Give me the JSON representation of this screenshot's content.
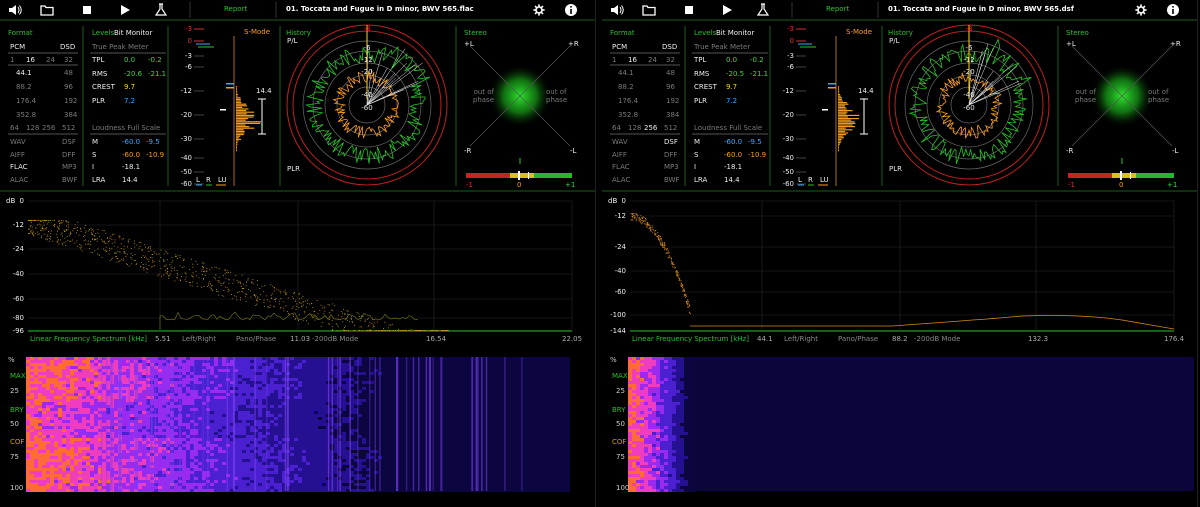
{
  "panels": [
    {
      "title": "01. Toccata and Fugue in D minor, BWV 565.flac",
      "report_label": "Report",
      "format": {
        "section_title": "Format",
        "pcm_label": "PCM",
        "dsd_label": "DSD",
        "bitdepths": [
          "1",
          "16",
          "24",
          "32"
        ],
        "rates_pcm": [
          "44.1",
          "88.2",
          "176.4",
          "352.8"
        ],
        "rates_dsd": [
          "48",
          "96",
          "192",
          "384"
        ],
        "multi": [
          "64",
          "128",
          "256",
          "512"
        ],
        "fmt_left": [
          "WAV",
          "AIFF",
          "FLAC",
          "ALAC"
        ],
        "fmt_right": [
          "DSF",
          "DFF",
          "MP3",
          "BWF"
        ]
      },
      "levels": {
        "section_title": "Levels",
        "bit_monitor": "Bit Monitor",
        "true_peak_title": "True Peak Meter",
        "rows": [
          {
            "label": "TPL",
            "v1": "0.0",
            "v2": "-0.2"
          },
          {
            "label": "RMS",
            "v1": "-20.6",
            "v2": "-21.1"
          },
          {
            "label": "CREST",
            "v1": "9.7",
            "v2": ""
          },
          {
            "label": "PLR",
            "v1": "7.2",
            "v2": ""
          }
        ],
        "loudness_title": "Loudness Full Scale",
        "loud_rows": [
          {
            "label": "M",
            "v1": "-60.0",
            "v2": "-9.5"
          },
          {
            "label": "S",
            "v1": "-60.0",
            "v2": "-10.9"
          },
          {
            "label": "I",
            "v1": "-18.1",
            "v2": ""
          },
          {
            "label": "LRA",
            "v1": "14.4",
            "v2": ""
          }
        ]
      },
      "meter": {
        "smode_label": "S-Mode",
        "scale": [
          "-3",
          "0",
          "-3",
          "-6",
          "-12",
          "-20",
          "-30",
          "-40",
          "-50",
          "-60"
        ],
        "plr_value": "14.4",
        "legend": [
          "L",
          "R",
          "LU"
        ]
      },
      "history": {
        "section_title": "History",
        "pl_label": "P/L",
        "plr_label": "PLR",
        "ring_labels": [
          "-3",
          "-6",
          "-12",
          "-20",
          "-40",
          "-60"
        ]
      },
      "stereo": {
        "section_title": "Stereo",
        "corner_labels": [
          "+L",
          "+R",
          "-R",
          "-L"
        ],
        "out_left": "out of phase",
        "out_right": "out of phase",
        "corr_scale": [
          "-1",
          "0",
          "+1"
        ]
      },
      "spectrum": {
        "db_label": "dB",
        "y_ticks": [
          "0",
          "-12",
          "-24",
          "-40",
          "-60",
          "-80",
          "-96"
        ],
        "x_ticks": [
          "5.51",
          "11.03",
          "16.54",
          "22.05"
        ],
        "title": "Linear Frequency Spectrum [kHz]",
        "modes": [
          "Left/Right",
          "Pano/Phase",
          "-200dB Mode"
        ]
      },
      "spectrogram": {
        "pct_label": "%",
        "ticks": [
          "25",
          "50",
          "75",
          "100"
        ],
        "marks": [
          "MAX",
          "BRY",
          "COF"
        ]
      }
    },
    {
      "title": "01. Toccata and Fugue in D minor, BWV 565.dsf",
      "report_label": "Report",
      "format": {
        "section_title": "Format",
        "pcm_label": "PCM",
        "dsd_label": "DSD",
        "bitdepths": [
          "1",
          "16",
          "24",
          "32"
        ],
        "rates_pcm": [
          "44.1",
          "88.2",
          "176.4",
          "352.8"
        ],
        "rates_dsd": [
          "48",
          "96",
          "192",
          "384"
        ],
        "multi": [
          "64",
          "128",
          "256",
          "512"
        ],
        "fmt_left": [
          "WAV",
          "AIFF",
          "FLAC",
          "ALAC"
        ],
        "fmt_right": [
          "DSF",
          "DFF",
          "MP3",
          "BWF"
        ]
      },
      "levels": {
        "section_title": "Levels",
        "bit_monitor": "Bit Monitor",
        "true_peak_title": "True Peak Meter",
        "rows": [
          {
            "label": "TPL",
            "v1": "0.0",
            "v2": "-0.2"
          },
          {
            "label": "RMS",
            "v1": "-20.5",
            "v2": "-21.1"
          },
          {
            "label": "CREST",
            "v1": "9.7",
            "v2": ""
          },
          {
            "label": "PLR",
            "v1": "7.2",
            "v2": ""
          }
        ],
        "loudness_title": "Loudness Full Scale",
        "loud_rows": [
          {
            "label": "M",
            "v1": "-60.0",
            "v2": "-9.5"
          },
          {
            "label": "S",
            "v1": "-60.0",
            "v2": "-10.9"
          },
          {
            "label": "I",
            "v1": "-18.1",
            "v2": ""
          },
          {
            "label": "LRA",
            "v1": "14.4",
            "v2": ""
          }
        ]
      },
      "meter": {
        "smode_label": "S-Mode",
        "scale": [
          "-3",
          "0",
          "-3",
          "-6",
          "-12",
          "-20",
          "-30",
          "-40",
          "-50",
          "-60"
        ],
        "plr_value": "14.4",
        "legend": [
          "L",
          "R",
          "LU"
        ]
      },
      "history": {
        "section_title": "History",
        "pl_label": "P/L",
        "plr_label": "PLR",
        "ring_labels": [
          "-3",
          "-6",
          "-12",
          "-20",
          "-40",
          "-60"
        ]
      },
      "stereo": {
        "section_title": "Stereo",
        "corner_labels": [
          "+L",
          "+R",
          "-R",
          "-L"
        ],
        "out_left": "out of phase",
        "out_right": "out of phase",
        "corr_scale": [
          "-1",
          "0",
          "+1"
        ]
      },
      "spectrum": {
        "db_label": "dB",
        "y_ticks": [
          "0",
          "-12",
          "-24",
          "-40",
          "-60",
          "-100",
          "-144"
        ],
        "x_ticks": [
          "44.1",
          "88.2",
          "132.3",
          "176.4"
        ],
        "title": "Linear Frequency Spectrum [kHz]",
        "modes": [
          "Left/Right",
          "Pano/Phase",
          "-200dB Mode"
        ]
      },
      "spectrogram": {
        "pct_label": "%",
        "ticks": [
          "25",
          "50",
          "75",
          "100"
        ],
        "marks": [
          "MAX",
          "BRY",
          "COF"
        ]
      }
    }
  ],
  "colors": {
    "accent_green": "#2fbf2f",
    "meter_orange": "#ff9d1a",
    "level_blue": "#3aa8ff",
    "peak_red": "#e23030"
  },
  "icons": [
    "volume-icon",
    "folder-icon",
    "stop-icon",
    "play-icon",
    "flask-icon",
    "gear-icon",
    "info-icon"
  ]
}
